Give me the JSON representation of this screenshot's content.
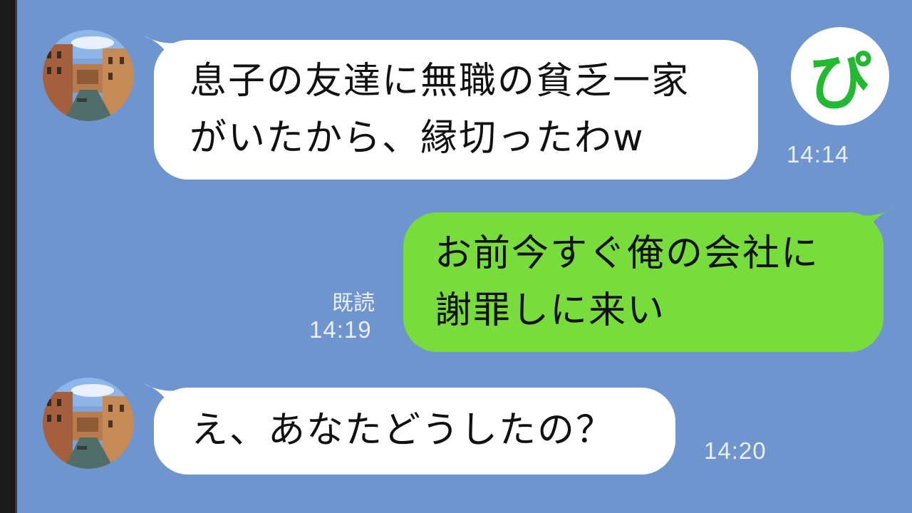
{
  "chat": {
    "messages": [
      {
        "side": "incoming",
        "lines": [
          "息子の友達に無職の貧乏一家",
          "がいたから、縁切ったわw"
        ],
        "time": "14:14"
      },
      {
        "side": "outgoing",
        "lines": [
          "お前今すぐ俺の会社に",
          "謝罪しに来い"
        ],
        "time": "14:19",
        "read_label": "既読"
      },
      {
        "side": "incoming",
        "lines": [
          "え、あなたどうしたの？"
        ],
        "time": "14:20"
      }
    ]
  },
  "badge": {
    "glyph": "ぴ",
    "color": "#22b832"
  },
  "colors": {
    "background": "#6f95cf",
    "incoming_bubble": "#ffffff",
    "outgoing_bubble": "#78dc3c"
  },
  "icons": {
    "avatar": "venice-canal-photo",
    "badge": "pi-logo-icon"
  }
}
